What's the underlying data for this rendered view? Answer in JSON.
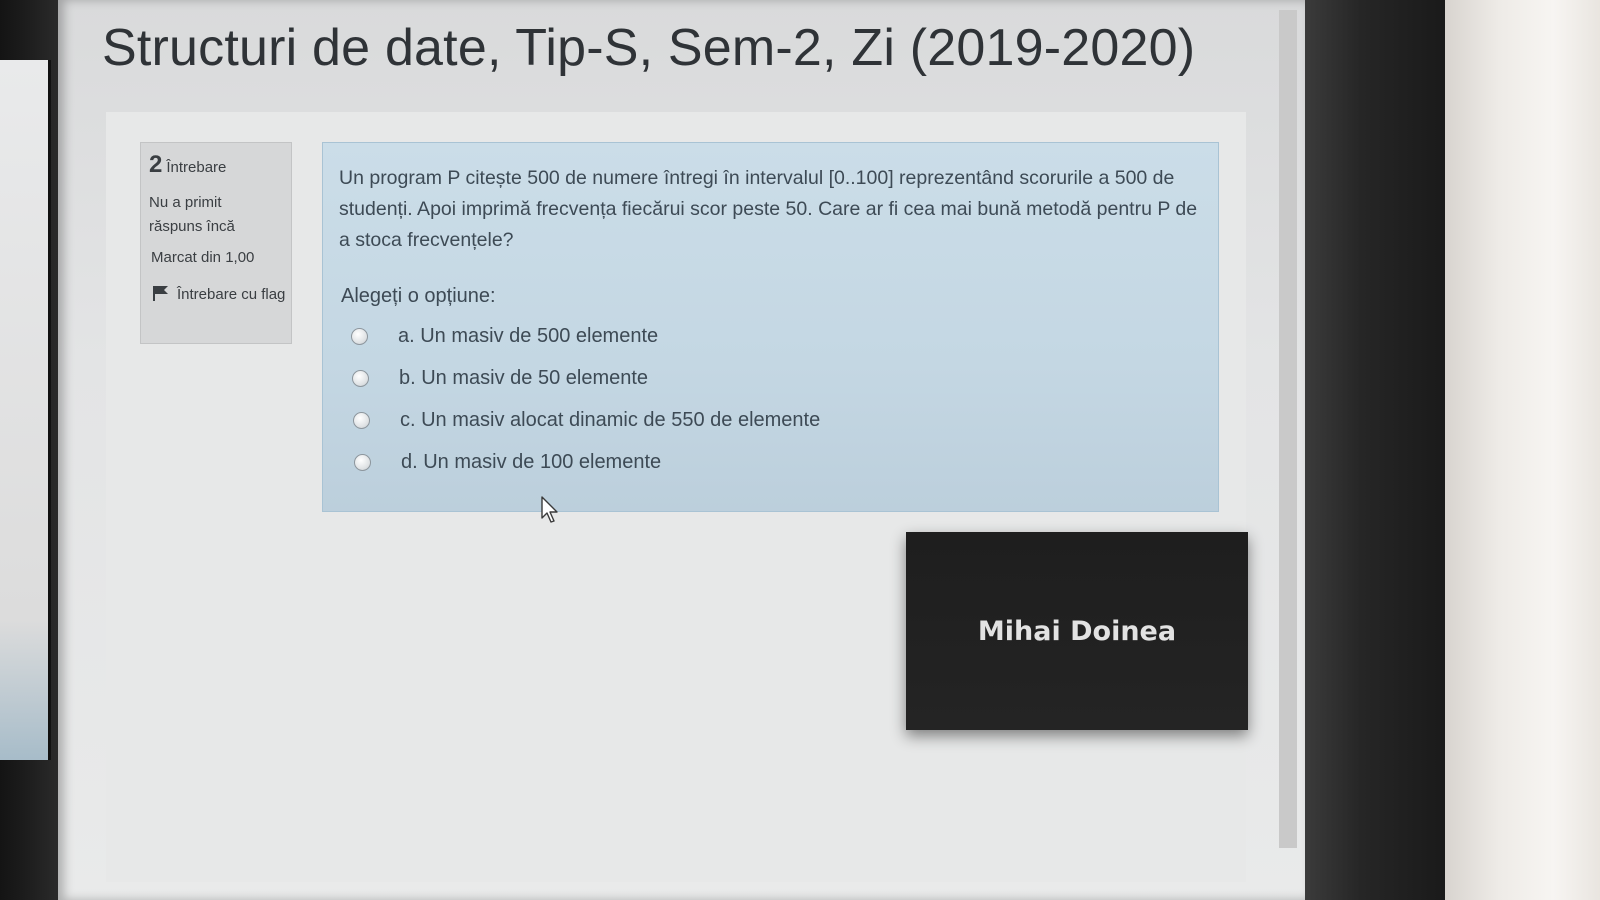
{
  "page": {
    "title": "Structuri de date, Tip-S, Sem-2, Zi (2019-2020)"
  },
  "question_info": {
    "number": "2",
    "label": "Întrebare",
    "state": "Nu a primit răspuns încă",
    "grade": "Marcat din 1,00",
    "flag_label": "Întrebare cu flag",
    "flag_icon": "flag-icon"
  },
  "question": {
    "text": "Un program P citește 500 de numere întregi în intervalul [0..100] reprezentând scorurile a 500 de studenți. Apoi imprimă frecvența fiecărui scor peste 50. Care ar fi cea mai bună metodă pentru P de a stoca frecvențele?",
    "prompt": "Alegeți o opțiune:",
    "answers": [
      {
        "label": "a. Un masiv de 500 elemente",
        "selected": false
      },
      {
        "label": "b. Un masiv de 50 elemente",
        "selected": false
      },
      {
        "label": "c. Un masiv alocat dinamic de 550 de elemente",
        "selected": false
      },
      {
        "label": "d. Un masiv de 100 elemente",
        "selected": false
      }
    ]
  },
  "video_overlay": {
    "participant_name": "Mihai Doinea"
  },
  "colors": {
    "question_bg": "#c4d7e3",
    "info_bg": "#d6d7d8",
    "tile_bg": "#222222"
  }
}
